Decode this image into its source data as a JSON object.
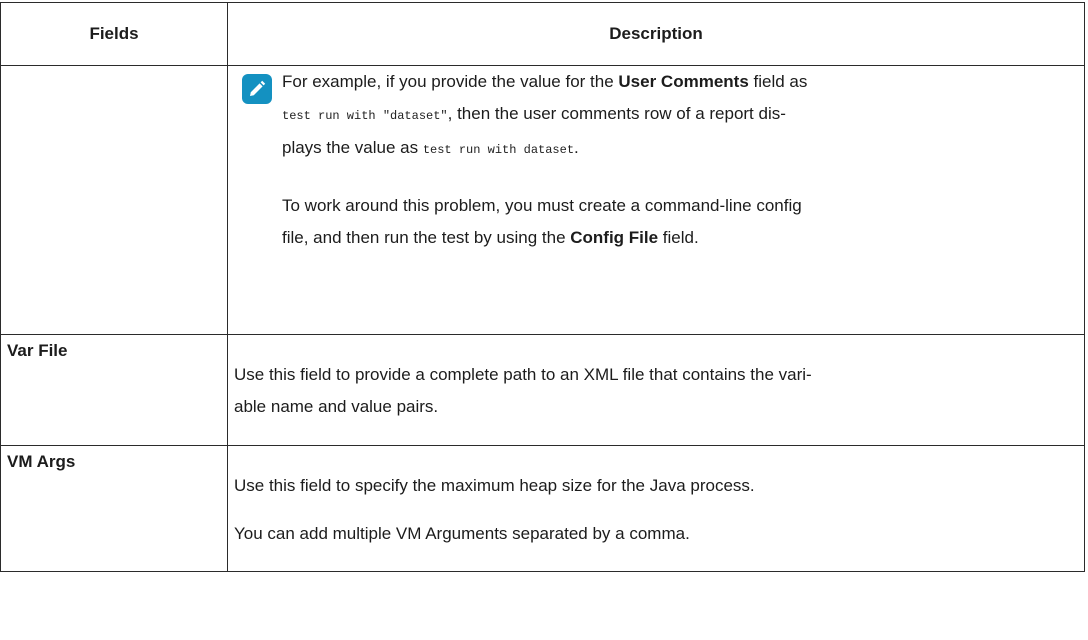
{
  "table": {
    "header": {
      "col1": "Fields",
      "col2": "Description"
    },
    "row1": {
      "field": "",
      "note_icon": "pencil-icon",
      "p1_a": "For example, if you provide the value for the ",
      "p1_b": "User Comments",
      "p1_c": " field as ",
      "p1_code1": "test run with \"dataset\"",
      "p1_d": ", then the user comments row of a report dis-",
      "p1_e": "plays the value as ",
      "p1_code2": "test run with dataset",
      "p1_f": ".",
      "p2_a": "To work around this problem, you must create a command-line config",
      "p2_b": "file, and then run the test by using the ",
      "p2_c": "Config File",
      "p2_d": " field."
    },
    "row2": {
      "field": "Var File",
      "p1_a": "Use this field to provide a complete path to an XML file that contains the vari-",
      "p1_b": "able name and value pairs."
    },
    "row3": {
      "field": "VM Args",
      "p1": "Use this field to specify the maximum heap size for the Java process.",
      "p2": "You can add multiple VM Arguments separated by a comma."
    },
    "colors": {
      "note_icon_bg": "#1491c1",
      "border": "#2b2b2b"
    }
  }
}
